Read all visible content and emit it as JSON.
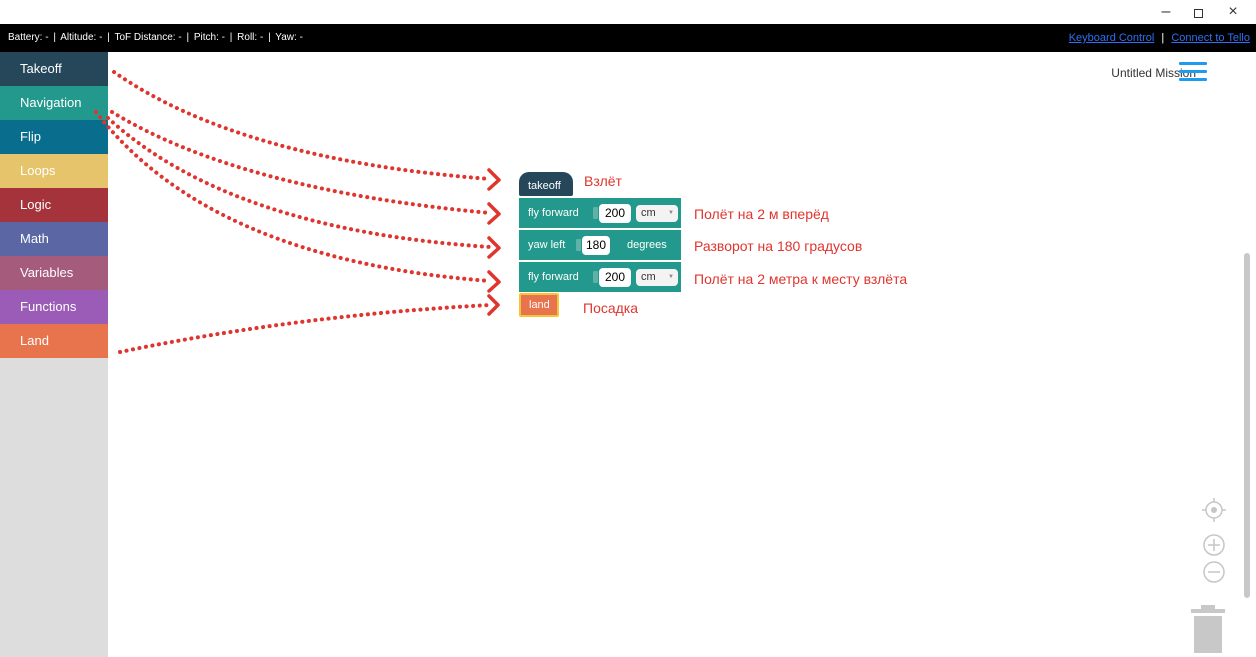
{
  "window": {
    "minimize": "–",
    "close": "×"
  },
  "status": {
    "items": [
      "Battery: -",
      "|",
      "Altitude: -",
      "|",
      "ToF Distance: -",
      "|",
      "Pitch: -",
      "|",
      "Roll: -",
      "|",
      "Yaw: -"
    ],
    "keyboard_link": "Keyboard Control",
    "separator": "|",
    "connect_link": "Connect to Tello"
  },
  "toolbox": {
    "categories": [
      {
        "label": "Takeoff",
        "color": "#26465a"
      },
      {
        "label": "Navigation",
        "color": "#23998d"
      },
      {
        "label": "Flip",
        "color": "#096e8d"
      },
      {
        "label": "Loops",
        "color": "#e5c46c"
      },
      {
        "label": "Logic",
        "color": "#a5333b"
      },
      {
        "label": "Math",
        "color": "#5b67a4"
      },
      {
        "label": "Variables",
        "color": "#a55b7b"
      },
      {
        "label": "Functions",
        "color": "#9a5cb7"
      },
      {
        "label": "Land",
        "color": "#e8744d"
      }
    ]
  },
  "workspace": {
    "mission_title": "Untitled Mission",
    "blocks": {
      "takeoff": {
        "label": "takeoff"
      },
      "fly_forward_1": {
        "label": "fly forward",
        "value": "200",
        "unit": "cm"
      },
      "yaw_left": {
        "label": "yaw left",
        "value": "180",
        "unit_label": "degrees"
      },
      "fly_forward_2": {
        "label": "fly forward",
        "value": "200",
        "unit": "cm"
      },
      "land": {
        "label": "land"
      }
    },
    "annotations": {
      "takeoff": "Взлёт",
      "fly_forward_1": "Полёт на 2 м вперёд",
      "yaw_left": "Разворот на 180 градусов",
      "fly_forward_2": "Полёт на 2 метра к месту взлёта",
      "land": "Посадка"
    }
  },
  "colors": {
    "annotation": "#e0352e",
    "link": "#2f6ff5"
  },
  "icons": [
    "minimize-icon",
    "restore-icon",
    "close-icon",
    "hamburger-menu-icon",
    "center-target-icon",
    "zoom-in-icon",
    "zoom-out-icon",
    "trash-icon"
  ]
}
